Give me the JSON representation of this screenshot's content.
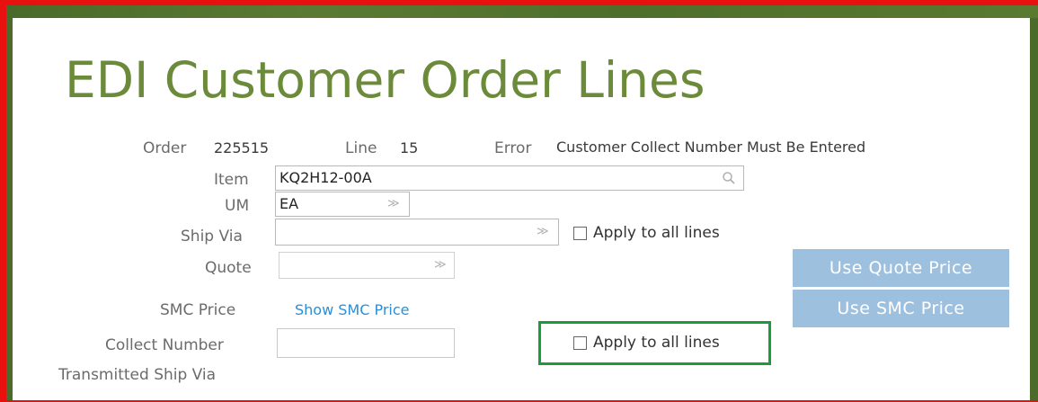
{
  "page": {
    "title": "EDI Customer Order Lines"
  },
  "header_fields": {
    "order_label": "Order",
    "order_value": "225515",
    "line_label": "Line",
    "line_value": "15",
    "error_label": "Error",
    "error_value": "Customer Collect Number Must Be Entered"
  },
  "form": {
    "item_label": "Item",
    "item_value": "KQ2H12-00A",
    "item_icon": "search-icon",
    "um_label": "UM",
    "um_value": "EA",
    "ship_via_label": "Ship Via",
    "ship_via_value": "",
    "ship_via_apply_label": "Apply to all lines",
    "quote_label": "Quote",
    "quote_value": "",
    "smc_price_label": "SMC Price",
    "smc_price_link": "Show SMC Price",
    "collect_number_label": "Collect Number",
    "collect_number_value": "",
    "collect_apply_label": "Apply to all lines",
    "transmitted_ship_via_label": "Transmitted Ship Via"
  },
  "buttons": {
    "use_quote_price": "Use Quote Price",
    "use_smc_price": "Use SMC Price"
  },
  "colors": {
    "title": "#6b8a3a",
    "frame": "#e8110f",
    "button_bg": "#9ec0df",
    "link": "#2a8fd6",
    "highlight": "#1e9a3a"
  }
}
